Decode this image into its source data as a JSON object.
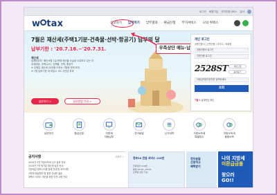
{
  "util_links": [
    "로그인",
    "회원가입",
    "전자민원서비스",
    "분야"
  ],
  "header": {
    "logo_left": "w",
    "logo_right": "tax",
    "nav": [
      "신고하기",
      "납부하기",
      "납부결과",
      "환급신청",
      "부가서비스",
      "나의 위택스"
    ],
    "active_nav": "납부하기"
  },
  "banner": {
    "title": "7월은 재산세(주택1기분·건축물·선박·항공기) 납부의 달",
    "due": "납부기한 : '20.7.16.~'20.7.31.",
    "body_lines": [
      "재산세",
      "납세의무자: 매년 6월 1일 현재 재산을 사실상 소유하고 있는 자",
      "과세대상: 주택(1/2), 건축물, 선박, 항공기",
      "※ 주택분 재산세 20만원 이하는 7월에 전액 부과",
      "※ 7월 납부기한 내 미납시 3% 가산금 부과"
    ],
    "btn_primary": "납부하기 >",
    "btn_secondary": "납부방법 안내 >"
  },
  "callout": "우측상단 메뉴-납부하기 선택",
  "login": {
    "title": "개인 로그인",
    "tabs": "공동인증서 | 간편인증 | 아이디 | 비회원",
    "field1": "공동인증서 로그인",
    "field2": "간편인증 로그인",
    "captcha": "2528ST",
    "cap_btn1": "새로고침",
    "cap_btn2": "음성듣기",
    "captcha_placeholder": "자동입력방지문자를 입력하세요.",
    "submit": "조회",
    "foot_badge": "N",
    "foot": "납세번호 확인",
    "status_badge": "7월"
  },
  "quick_menu": [
    {
      "label": "납부하기",
      "icon": "wallet-icon"
    },
    {
      "label": "환급신청",
      "icon": "document-icon"
    },
    {
      "label": "지방세\n자동납부",
      "icon": "monitor-icon"
    },
    {
      "label": "전자송달",
      "icon": "mail-icon"
    },
    {
      "label": "신고내역",
      "icon": "list-icon"
    },
    {
      "label": "지방소득세\n특별징수",
      "icon": "coins-icon"
    },
    {
      "label": "지방소득세\n종합소득",
      "icon": "coins-icon"
    }
  ],
  "notice": {
    "title": "공지사항",
    "more": "더보기 +",
    "items": [
      "2020년 5월 지방소득세 신고·납부 안내",
      "2020년 7월 정기분 재산세 납부 안내",
      "지방세입 정보시스템 장애 안내 및 조치사항",
      "지방세 체납정리 및 압류 안내문 발송",
      "위택스 서비스 개선을 위한 의견 수렴 안내"
    ]
  },
  "ads": {
    "ad1_title": "정부24 민원 서비스 110번",
    "ad1_body": "전화상담 110번\n평일 09:00~18:00\n모바일 상담 가능",
    "ad2_title": "전자송달\n신청하고\n혜택받기",
    "ad3_line1": "나의 지방세",
    "ad3_line2": "미환급금을",
    "ad3_line3": "찾으러\nGO!!"
  },
  "colors": {
    "accent": "#1b3f7a",
    "highlight": "#e8264a",
    "frame": "#bb88c8"
  }
}
